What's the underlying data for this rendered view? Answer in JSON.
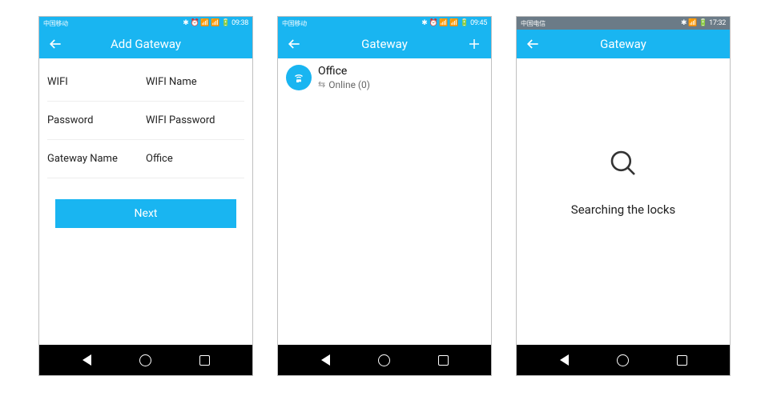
{
  "colors": {
    "accent": "#19b5f1"
  },
  "screen1": {
    "statusbar": {
      "carrier": "中国移动",
      "time": "09:38",
      "icons": "✱ ⏰ 📶 📶 🔋"
    },
    "header": {
      "title": "Add Gateway"
    },
    "fields": {
      "wifi": {
        "label": "WIFI",
        "value": "WIFI Name"
      },
      "password": {
        "label": "Password",
        "value": "WIFI Password"
      },
      "gateway_name": {
        "label": "Gateway Name",
        "value": "Office"
      }
    },
    "button": "Next"
  },
  "screen2": {
    "statusbar": {
      "carrier": "中国移动",
      "time": "09:45",
      "icons": "✱ ⏰ 📶 📶 🔋"
    },
    "header": {
      "title": "Gateway"
    },
    "item": {
      "name": "Office",
      "status_text": "Online (0)"
    }
  },
  "screen3": {
    "statusbar": {
      "carrier": "中国电信",
      "time": "17:32",
      "icons": "✱ ⚡ 📶 🔋"
    },
    "header": {
      "title": "Gateway"
    },
    "searching_text": "Searching the locks"
  }
}
